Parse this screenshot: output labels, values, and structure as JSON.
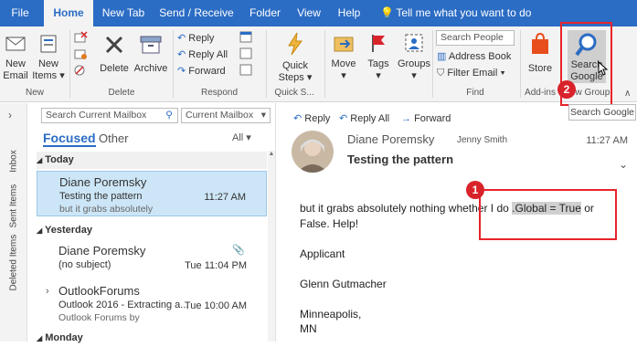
{
  "tabs": [
    "File",
    "Home",
    "New Tab",
    "Send / Receive",
    "Folder",
    "View",
    "Help"
  ],
  "tell_me": "Tell me what you want to do",
  "ribbon": {
    "new_email": [
      "New",
      "Email"
    ],
    "new_items": [
      "New",
      "Items ▾"
    ],
    "new_group": "New",
    "delete_btn": "Delete",
    "archive_btn": "Archive",
    "delete_group": "Delete",
    "reply": "Reply",
    "reply_all": "Reply All",
    "forward": "Forward",
    "respond_group": "Respond",
    "quick_steps": [
      "Quick",
      "Steps ▾"
    ],
    "quick_group": "Quick S...",
    "move": "Move",
    "move_arrow": "▾",
    "tags": "Tags",
    "tags_arrow": "▾",
    "groups": "Groups",
    "groups_arrow": "▾",
    "search_people_placeholder": "Search People",
    "address_book": "Address Book",
    "filter_email": "Filter Email ▾",
    "find_group": "Find",
    "store": "Store",
    "addins_group": "Add-ins",
    "search_google": [
      "Search",
      "Google"
    ],
    "new_group2": "New Group",
    "tooltip": "Search Google"
  },
  "leftnav": [
    "Inbox",
    "Sent Items",
    "Deleted Items"
  ],
  "list": {
    "search_placeholder": "Search Current Mailbox",
    "scope": "Current Mailbox",
    "focused": "Focused",
    "other": "Other",
    "all": "All",
    "groups": [
      {
        "name": "Today"
      },
      {
        "name": "Yesterday"
      },
      {
        "name": "Monday"
      }
    ],
    "mails": [
      {
        "sender": "Diane Poremsky",
        "subject": "Testing the pattern",
        "time": "11:27 AM",
        "preview": "but it grabs absolutely"
      },
      {
        "sender": "Diane Poremsky",
        "subject": "(no subject)",
        "time": "Tue 11:04 PM",
        "preview": ""
      },
      {
        "sender": "OutlookForums",
        "subject": "Outlook 2016 - Extracting a...",
        "time": "Tue 10:00 AM",
        "preview": "Outlook Forums by"
      }
    ]
  },
  "reading": {
    "reply": "Reply",
    "reply_all": "Reply All",
    "forward": "Forward",
    "from": "Diane Poremsky",
    "to": "Jenny Smith",
    "time": "11:27 AM",
    "subject": "Testing the pattern",
    "body_line1a": "but it grabs absolutely nothing whether I do ",
    "body_highlight": ".Global = True",
    "body_line1b": " or",
    "body_line2": "False. Help!",
    "body_line3": "Applicant",
    "body_line4": "Glenn Gutmacher",
    "body_line5": "Minneapolis,",
    "body_line6": "MN"
  },
  "callouts": {
    "one": "1",
    "two": "2"
  },
  "colors": {
    "accent": "#2b6cc4",
    "selected": "#cde6f7",
    "callout": "#e8232a"
  }
}
